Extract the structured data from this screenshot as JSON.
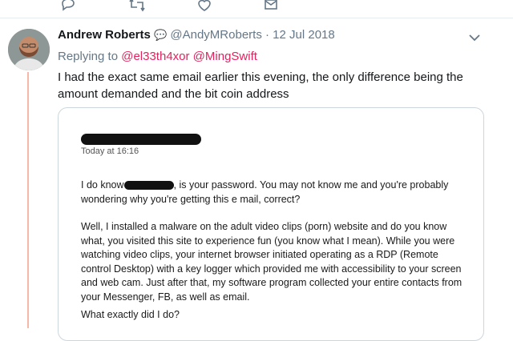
{
  "tweet": {
    "display_name": "Andrew Roberts",
    "handle": "@AndyMRoberts",
    "separator": "·",
    "date": "12 Jul 2018",
    "replying_label": "Replying to",
    "mentions": [
      "@el33th4xor",
      "@MingSwift"
    ],
    "text": "I had the exact same email earlier this evening, the only difference being the amount demanded and the bit coin address",
    "emoji": "💬"
  },
  "actions": {
    "icons": [
      "reply-icon",
      "retweet-icon",
      "like-icon",
      "message-icon"
    ]
  },
  "email": {
    "timestamp": "Today at 16:16",
    "p1_before": "I do know",
    "p1_after": ", is your password. You may not know me and you're probably wondering why you're getting this e mail, correct?",
    "p2": "Well, I installed a malware on the adult video clips (porn) website and do you know what, you visited this site to experience fun (you know what I mean). While you were watching video clips, your internet browser initiated operating as a RDP (Remote control Desktop) with a key logger which provided me with accessibility to your screen and web cam. Just after that, my software program collected your entire contacts from your Messenger, FB, as well as email.",
    "p3": "What exactly did I do?"
  },
  "colors": {
    "name": "#14171a",
    "meta": "#657786",
    "mention": "#e0245e",
    "thread": "#f7b8a8",
    "border": "#ccd6dd"
  }
}
